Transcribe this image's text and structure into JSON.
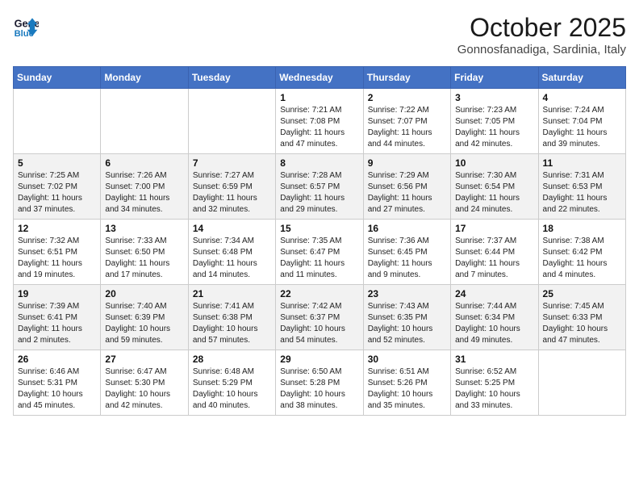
{
  "header": {
    "logo_line1": "General",
    "logo_line2": "Blue",
    "month": "October 2025",
    "location": "Gonnosfanadiga, Sardinia, Italy"
  },
  "weekdays": [
    "Sunday",
    "Monday",
    "Tuesday",
    "Wednesday",
    "Thursday",
    "Friday",
    "Saturday"
  ],
  "weeks": [
    [
      null,
      null,
      null,
      {
        "day": "1",
        "sunrise": "Sunrise: 7:21 AM",
        "sunset": "Sunset: 7:08 PM",
        "daylight": "Daylight: 11 hours and 47 minutes."
      },
      {
        "day": "2",
        "sunrise": "Sunrise: 7:22 AM",
        "sunset": "Sunset: 7:07 PM",
        "daylight": "Daylight: 11 hours and 44 minutes."
      },
      {
        "day": "3",
        "sunrise": "Sunrise: 7:23 AM",
        "sunset": "Sunset: 7:05 PM",
        "daylight": "Daylight: 11 hours and 42 minutes."
      },
      {
        "day": "4",
        "sunrise": "Sunrise: 7:24 AM",
        "sunset": "Sunset: 7:04 PM",
        "daylight": "Daylight: 11 hours and 39 minutes."
      }
    ],
    [
      {
        "day": "5",
        "sunrise": "Sunrise: 7:25 AM",
        "sunset": "Sunset: 7:02 PM",
        "daylight": "Daylight: 11 hours and 37 minutes."
      },
      {
        "day": "6",
        "sunrise": "Sunrise: 7:26 AM",
        "sunset": "Sunset: 7:00 PM",
        "daylight": "Daylight: 11 hours and 34 minutes."
      },
      {
        "day": "7",
        "sunrise": "Sunrise: 7:27 AM",
        "sunset": "Sunset: 6:59 PM",
        "daylight": "Daylight: 11 hours and 32 minutes."
      },
      {
        "day": "8",
        "sunrise": "Sunrise: 7:28 AM",
        "sunset": "Sunset: 6:57 PM",
        "daylight": "Daylight: 11 hours and 29 minutes."
      },
      {
        "day": "9",
        "sunrise": "Sunrise: 7:29 AM",
        "sunset": "Sunset: 6:56 PM",
        "daylight": "Daylight: 11 hours and 27 minutes."
      },
      {
        "day": "10",
        "sunrise": "Sunrise: 7:30 AM",
        "sunset": "Sunset: 6:54 PM",
        "daylight": "Daylight: 11 hours and 24 minutes."
      },
      {
        "day": "11",
        "sunrise": "Sunrise: 7:31 AM",
        "sunset": "Sunset: 6:53 PM",
        "daylight": "Daylight: 11 hours and 22 minutes."
      }
    ],
    [
      {
        "day": "12",
        "sunrise": "Sunrise: 7:32 AM",
        "sunset": "Sunset: 6:51 PM",
        "daylight": "Daylight: 11 hours and 19 minutes."
      },
      {
        "day": "13",
        "sunrise": "Sunrise: 7:33 AM",
        "sunset": "Sunset: 6:50 PM",
        "daylight": "Daylight: 11 hours and 17 minutes."
      },
      {
        "day": "14",
        "sunrise": "Sunrise: 7:34 AM",
        "sunset": "Sunset: 6:48 PM",
        "daylight": "Daylight: 11 hours and 14 minutes."
      },
      {
        "day": "15",
        "sunrise": "Sunrise: 7:35 AM",
        "sunset": "Sunset: 6:47 PM",
        "daylight": "Daylight: 11 hours and 11 minutes."
      },
      {
        "day": "16",
        "sunrise": "Sunrise: 7:36 AM",
        "sunset": "Sunset: 6:45 PM",
        "daylight": "Daylight: 11 hours and 9 minutes."
      },
      {
        "day": "17",
        "sunrise": "Sunrise: 7:37 AM",
        "sunset": "Sunset: 6:44 PM",
        "daylight": "Daylight: 11 hours and 7 minutes."
      },
      {
        "day": "18",
        "sunrise": "Sunrise: 7:38 AM",
        "sunset": "Sunset: 6:42 PM",
        "daylight": "Daylight: 11 hours and 4 minutes."
      }
    ],
    [
      {
        "day": "19",
        "sunrise": "Sunrise: 7:39 AM",
        "sunset": "Sunset: 6:41 PM",
        "daylight": "Daylight: 11 hours and 2 minutes."
      },
      {
        "day": "20",
        "sunrise": "Sunrise: 7:40 AM",
        "sunset": "Sunset: 6:39 PM",
        "daylight": "Daylight: 10 hours and 59 minutes."
      },
      {
        "day": "21",
        "sunrise": "Sunrise: 7:41 AM",
        "sunset": "Sunset: 6:38 PM",
        "daylight": "Daylight: 10 hours and 57 minutes."
      },
      {
        "day": "22",
        "sunrise": "Sunrise: 7:42 AM",
        "sunset": "Sunset: 6:37 PM",
        "daylight": "Daylight: 10 hours and 54 minutes."
      },
      {
        "day": "23",
        "sunrise": "Sunrise: 7:43 AM",
        "sunset": "Sunset: 6:35 PM",
        "daylight": "Daylight: 10 hours and 52 minutes."
      },
      {
        "day": "24",
        "sunrise": "Sunrise: 7:44 AM",
        "sunset": "Sunset: 6:34 PM",
        "daylight": "Daylight: 10 hours and 49 minutes."
      },
      {
        "day": "25",
        "sunrise": "Sunrise: 7:45 AM",
        "sunset": "Sunset: 6:33 PM",
        "daylight": "Daylight: 10 hours and 47 minutes."
      }
    ],
    [
      {
        "day": "26",
        "sunrise": "Sunrise: 6:46 AM",
        "sunset": "Sunset: 5:31 PM",
        "daylight": "Daylight: 10 hours and 45 minutes."
      },
      {
        "day": "27",
        "sunrise": "Sunrise: 6:47 AM",
        "sunset": "Sunset: 5:30 PM",
        "daylight": "Daylight: 10 hours and 42 minutes."
      },
      {
        "day": "28",
        "sunrise": "Sunrise: 6:48 AM",
        "sunset": "Sunset: 5:29 PM",
        "daylight": "Daylight: 10 hours and 40 minutes."
      },
      {
        "day": "29",
        "sunrise": "Sunrise: 6:50 AM",
        "sunset": "Sunset: 5:28 PM",
        "daylight": "Daylight: 10 hours and 38 minutes."
      },
      {
        "day": "30",
        "sunrise": "Sunrise: 6:51 AM",
        "sunset": "Sunset: 5:26 PM",
        "daylight": "Daylight: 10 hours and 35 minutes."
      },
      {
        "day": "31",
        "sunrise": "Sunrise: 6:52 AM",
        "sunset": "Sunset: 5:25 PM",
        "daylight": "Daylight: 10 hours and 33 minutes."
      },
      null
    ]
  ]
}
